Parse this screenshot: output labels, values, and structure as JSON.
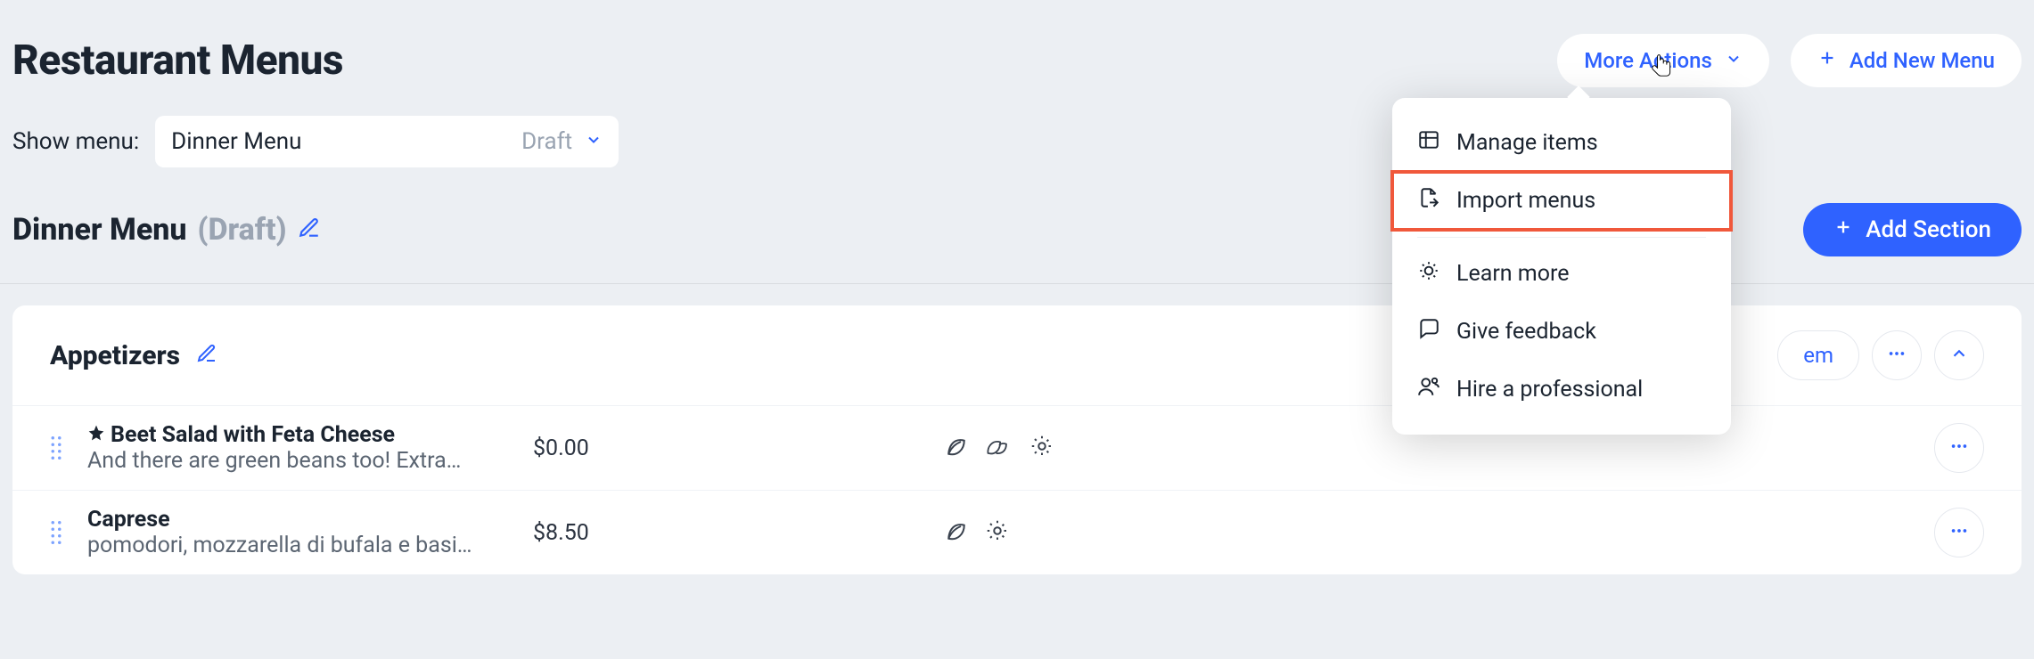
{
  "header": {
    "page_title": "Restaurant Menus",
    "more_actions_label": "More Actions",
    "add_menu_label": "Add New Menu"
  },
  "show_menu": {
    "label": "Show menu:",
    "selected": "Dinner Menu",
    "status": "Draft"
  },
  "sub": {
    "title": "Dinner Menu",
    "status": "(Draft)",
    "add_section_label": "Add Section"
  },
  "section": {
    "title": "Appetizers",
    "partial_action_label": "em"
  },
  "items": [
    {
      "starred": true,
      "title": "Beet Salad with Feta Cheese",
      "desc": "And there are green beans too! Extra…",
      "price": "$0.00",
      "tags": [
        "leaf",
        "double-leaf",
        "sun"
      ]
    },
    {
      "starred": false,
      "title": "Caprese",
      "desc": "pomodori, mozzarella di bufala e basi…",
      "price": "$8.50",
      "tags": [
        "leaf",
        "sun"
      ]
    }
  ],
  "dropdown": {
    "items": [
      {
        "icon": "grid",
        "label": "Manage items"
      },
      {
        "icon": "import",
        "label": "Import menus",
        "highlight": true
      },
      {
        "divider": true
      },
      {
        "icon": "bulb",
        "label": "Learn more"
      },
      {
        "icon": "chat",
        "label": "Give feedback"
      },
      {
        "icon": "pro",
        "label": "Hire a professional"
      }
    ]
  }
}
